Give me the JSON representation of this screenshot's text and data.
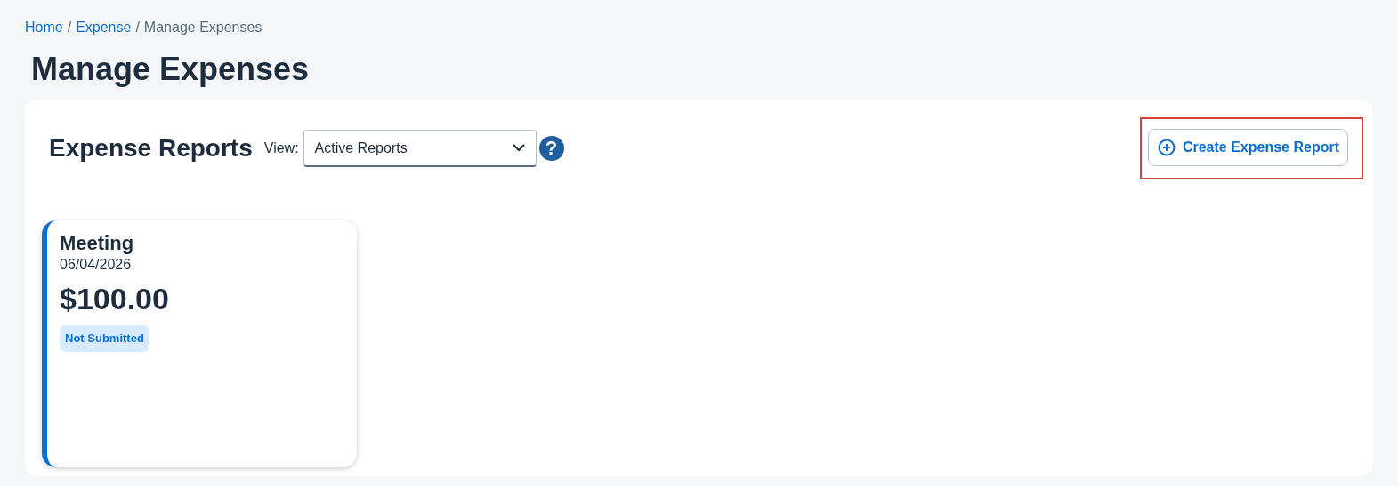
{
  "breadcrumb": [
    {
      "label": "Home",
      "current": false
    },
    {
      "label": "Expense",
      "current": false
    },
    {
      "label": "Manage Expenses",
      "current": true
    }
  ],
  "breadcrumb_separator": "/",
  "page_title": "Manage Expenses",
  "section": {
    "title": "Expense Reports",
    "view_label": "View:",
    "view_value": "Active Reports",
    "help": "?",
    "create_button": {
      "label": "Create Expense Report",
      "highlighted": true
    }
  },
  "reports": [
    {
      "name": "Meeting",
      "date": "06/04/2026",
      "amount": "$100.00",
      "status": "Not Submitted",
      "color": "#0a6ed1"
    }
  ]
}
